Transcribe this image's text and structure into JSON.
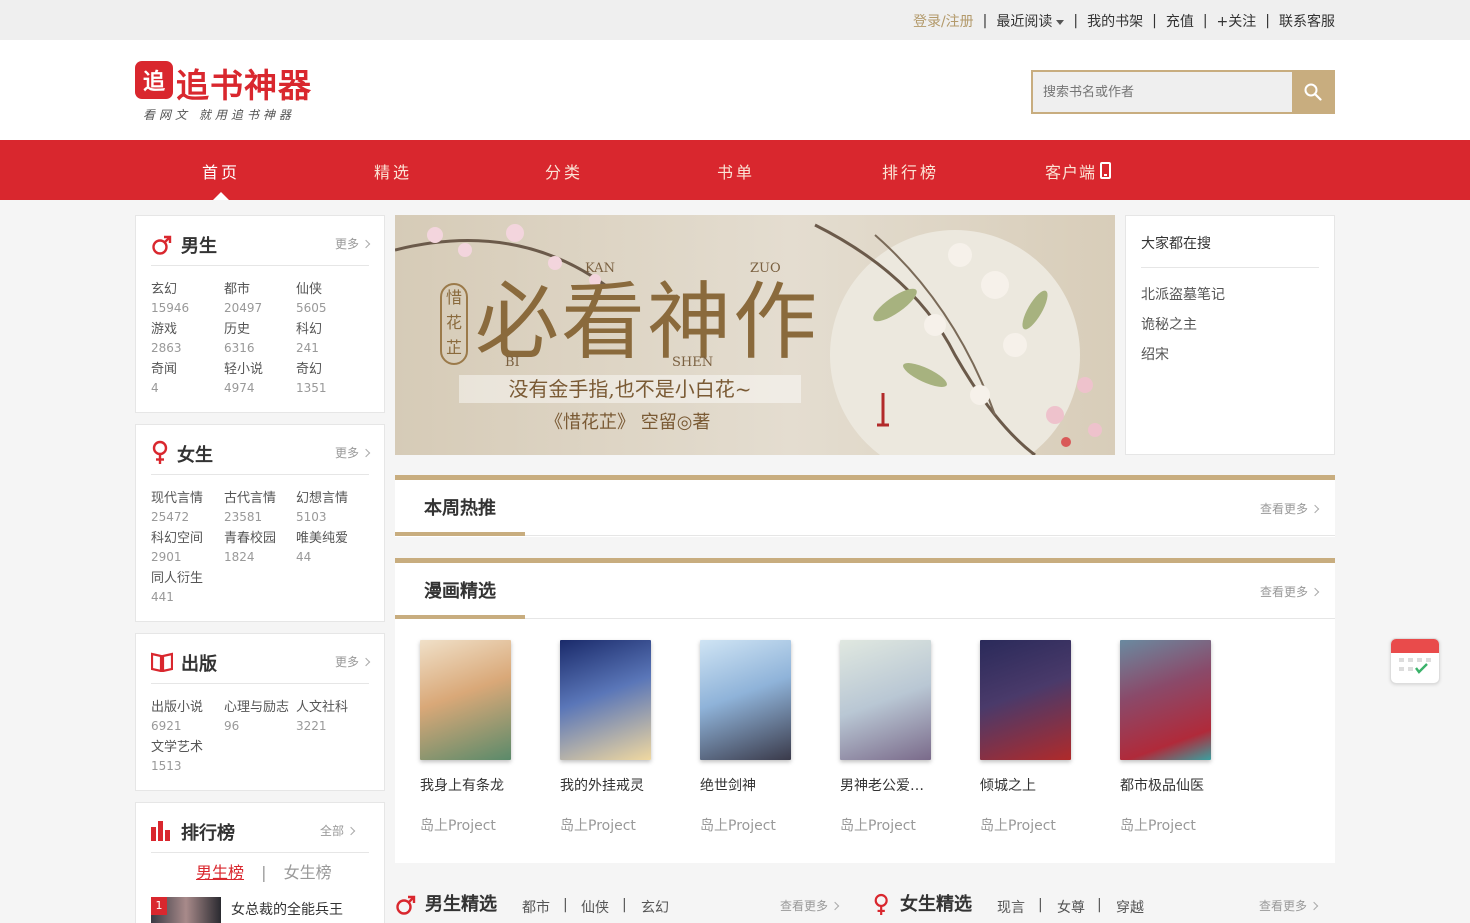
{
  "topbar": {
    "login": "登录/注册",
    "recent": "最近阅读",
    "shelf": "我的书架",
    "recharge": "充值",
    "follow": "+关注",
    "service": "联系客服"
  },
  "header": {
    "logo_mark": "追",
    "logo_text": "追书神器",
    "slogan": "看网文 就用追书神器",
    "search_placeholder": "搜索书名或作者"
  },
  "nav": {
    "items": [
      {
        "label": "首页"
      },
      {
        "label": "精选"
      },
      {
        "label": "分类"
      },
      {
        "label": "书单"
      },
      {
        "label": "排行榜"
      },
      {
        "label": "客户端"
      }
    ]
  },
  "male": {
    "title": "男生",
    "more": "更多",
    "cats": [
      {
        "name": "玄幻",
        "count": "15946"
      },
      {
        "name": "都市",
        "count": "20497"
      },
      {
        "name": "仙侠",
        "count": "5605"
      },
      {
        "name": "游戏",
        "count": "2863"
      },
      {
        "name": "历史",
        "count": "6316"
      },
      {
        "name": "科幻",
        "count": "241"
      },
      {
        "name": "奇闻",
        "count": "4"
      },
      {
        "name": "轻小说",
        "count": "4974"
      },
      {
        "name": "奇幻",
        "count": "1351"
      }
    ]
  },
  "female": {
    "title": "女生",
    "more": "更多",
    "cats": [
      {
        "name": "现代言情",
        "count": "25472"
      },
      {
        "name": "古代言情",
        "count": "23581"
      },
      {
        "name": "幻想言情",
        "count": "5103"
      },
      {
        "name": "科幻空间",
        "count": "2901"
      },
      {
        "name": "青春校园",
        "count": "1824"
      },
      {
        "name": "唯美纯爱",
        "count": "44"
      },
      {
        "name": "同人衍生",
        "count": "441"
      }
    ]
  },
  "publish": {
    "title": "出版",
    "more": "更多",
    "cats": [
      {
        "name": "出版小说",
        "count": "6921"
      },
      {
        "name": "心理与励志",
        "count": "96"
      },
      {
        "name": "人文社科",
        "count": "3221"
      },
      {
        "name": "文学艺术",
        "count": "1513"
      }
    ]
  },
  "ranking": {
    "title": "排行榜",
    "more": "全部",
    "tab_male": "男生榜",
    "tab_sep": "|",
    "tab_female": "女生榜",
    "first_rank": "1",
    "first_book": "女总裁的全能兵王"
  },
  "banner": {
    "seal": "惜花芷",
    "headline": "必看神作",
    "pinyin": [
      "KAN",
      "ZUO",
      "BI",
      "SHEN"
    ],
    "line1": "没有金手指,也不是小白花~",
    "line2": "《惜花芷》 空留◎著"
  },
  "hot_search": {
    "title": "大家都在搜",
    "items": [
      "北派盗墓笔记",
      "诡秘之主",
      "绍宋"
    ]
  },
  "weekly": {
    "title": "本周热推",
    "more": "查看更多"
  },
  "manga": {
    "title": "漫画精选",
    "more": "查看更多",
    "books": [
      {
        "title": "我身上有条龙",
        "author": "岛上Project",
        "color": "#d9b48f"
      },
      {
        "title": "我的外挂戒灵",
        "author": "岛上Project",
        "color": "#5a76b8"
      },
      {
        "title": "绝世剑神",
        "author": "岛上Project",
        "color": "#8fb3d9"
      },
      {
        "title": "男神老公爱…",
        "author": "岛上Project",
        "color": "#b9c7d4"
      },
      {
        "title": "倾城之上",
        "author": "岛上Project",
        "color": "#4a3a6a"
      },
      {
        "title": "都市极品仙医",
        "author": "岛上Project",
        "color": "#8a4a6a"
      }
    ]
  },
  "bottom": {
    "male_title": "男生精选",
    "male_tags": [
      "都市",
      "仙侠",
      "玄幻"
    ],
    "male_more": "查看更多",
    "female_title": "女生精选",
    "female_tags": [
      "现言",
      "女尊",
      "穿越"
    ],
    "female_more": "查看更多",
    "sep": "|"
  },
  "colors": {
    "brand_red": "#d9272e",
    "gold": "#c8ad7f",
    "login_gold": "#b39a6b"
  }
}
